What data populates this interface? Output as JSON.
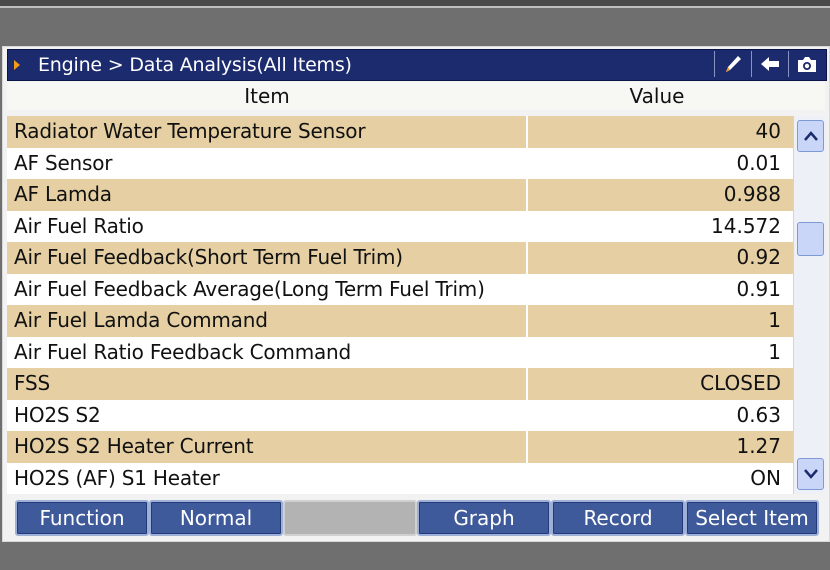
{
  "titlebar": {
    "breadcrumb": "Engine > Data Analysis(All Items)",
    "icons": [
      "pen-icon",
      "back-arrow-icon",
      "camera-icon"
    ]
  },
  "header": {
    "item": "Item",
    "value": "Value"
  },
  "rows": [
    {
      "item": "Radiator Water Temperature Sensor",
      "value": "40"
    },
    {
      "item": "AF Sensor",
      "value": "0.01"
    },
    {
      "item": "AF Lamda",
      "value": "0.988"
    },
    {
      "item": "Air Fuel Ratio",
      "value": "14.572"
    },
    {
      "item": "Air Fuel Feedback(Short Term Fuel Trim)",
      "value": "0.92"
    },
    {
      "item": "Air Fuel Feedback Average(Long Term Fuel Trim)",
      "value": "0.91"
    },
    {
      "item": "Air Fuel Lamda Command",
      "value": "1"
    },
    {
      "item": "Air Fuel Ratio Feedback Command",
      "value": "1"
    },
    {
      "item": "FSS",
      "value": "CLOSED"
    },
    {
      "item": "HO2S S2",
      "value": "0.63"
    },
    {
      "item": "HO2S S2 Heater Current",
      "value": "1.27"
    },
    {
      "item": "HO2S (AF) S1 Heater",
      "value": "ON"
    }
  ],
  "buttons": {
    "function": "Function",
    "normal": "Normal",
    "blank": "",
    "graph": "Graph",
    "record": "Record",
    "select_item": "Select Item"
  },
  "colors": {
    "titlebar": "#1c2a6e",
    "row_shaded": "#e5cfa3",
    "row_plain": "#ffffff",
    "button": "#3f5a9a"
  }
}
